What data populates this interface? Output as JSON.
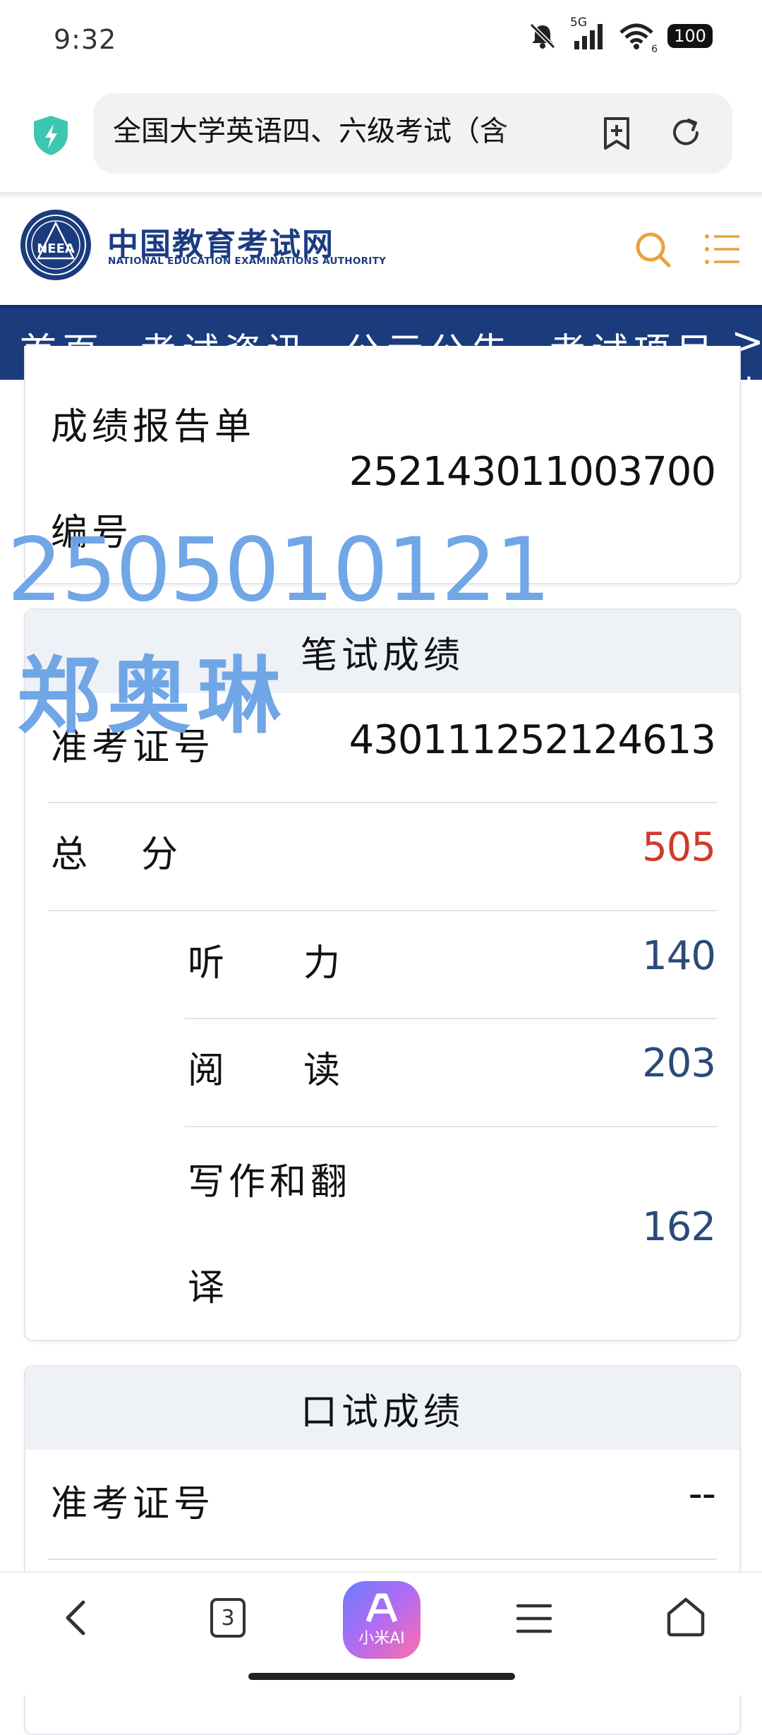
{
  "status_bar": {
    "time": "9:32",
    "network_label": "5G",
    "wifi_label": "6",
    "battery": "100"
  },
  "browser": {
    "url_title": "全国大学英语四、六级考试（含",
    "tab_count": "3"
  },
  "site": {
    "logo_text": "NEEA",
    "name": "中国教育考试网",
    "subname": "NATIONAL EDUCATION EXAMINATIONS AUTHORITY",
    "accent_color": "#1a3b7c",
    "icon_accent": "#e8a33a"
  },
  "nav": {
    "items": [
      "首页",
      "考试资讯",
      "公示公告",
      "考试项目"
    ],
    "more": ">考"
  },
  "report": {
    "label_line1": "成绩报告单",
    "label_line2": "编号",
    "number": "252143011003700"
  },
  "written": {
    "title": "笔试成绩",
    "ticket_label": "准考证号",
    "ticket_number": "430111252124613",
    "total_label_a": "总",
    "total_label_b": "分",
    "total_score": "505",
    "total_color": "#d0392b",
    "listening_label_a": "听",
    "listening_label_b": "力",
    "listening_score": "140",
    "reading_label_a": "阅",
    "reading_label_b": "读",
    "reading_score": "203",
    "writing_label_line1": "写作和翻",
    "writing_label_line2": "译",
    "writing_score": "162",
    "sub_score_color": "#2b4a7a"
  },
  "oral": {
    "title": "口试成绩",
    "ticket_label": "准考证号",
    "ticket_number": "--"
  },
  "watermark": {
    "number": "2505010121",
    "name": "郑奥琳",
    "color": "#6aa2e6"
  },
  "bottom_bar": {
    "ai_label": "小米AI"
  }
}
